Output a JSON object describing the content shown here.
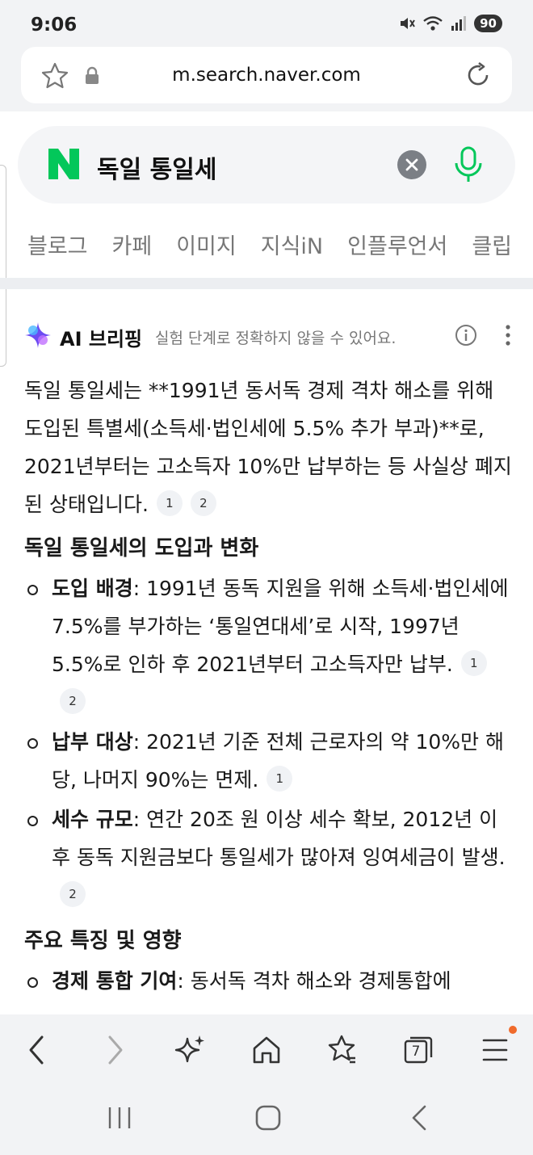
{
  "status_bar": {
    "time": "9:06",
    "battery": "90"
  },
  "browser": {
    "url": "m.search.naver.com"
  },
  "search": {
    "query": "독일 통일세"
  },
  "tabs": [
    "블로그",
    "카페",
    "이미지",
    "지식iN",
    "인플루언서",
    "클립"
  ],
  "ai_briefing": {
    "title": "AI 브리핑",
    "disclaimer": "실험 단계로 정확하지 않을 수 있어요.",
    "summary": "독일 통일세는 **1991년 동서독 경제 격차 해소를 위해 도입된 특별세(소득세·법인세에 5.5% 추가 부과)**로, 2021년부터는 고소득자 10%만 납부하는 등 사실상 폐지된 상태입니다.",
    "summary_cites": [
      "1",
      "2"
    ],
    "section1": {
      "title": "독일 통일세의 도입과 변화",
      "items": [
        {
          "term": "도입 배경",
          "text": ": 1991년 동독 지원을 위해 소득세·법인세에 7.5%를 부가하는 ‘통일연대세’로 시작, 1997년 5.5%로 인하 후 2021년부터 고소득자만 납부.",
          "cites": [
            "1",
            "2"
          ]
        },
        {
          "term": "납부 대상",
          "text": ": 2021년 기준 전체 근로자의 약 10%만 해당, 나머지 90%는 면제.",
          "cites": [
            "1"
          ]
        },
        {
          "term": "세수 규모",
          "text": ": 연간 20조 원 이상 세수 확보, 2012년 이후 동독 지원금보다 통일세가 많아져 잉여세금이 발생.",
          "cites": [
            "2"
          ]
        }
      ]
    },
    "section2": {
      "title": "주요 특징 및 영향",
      "items": [
        {
          "term": "경제 통합 기여",
          "text": ": 동서독 격차 해소와 경제통합에"
        }
      ]
    }
  },
  "toolbar": {
    "tabs_count": "7"
  }
}
